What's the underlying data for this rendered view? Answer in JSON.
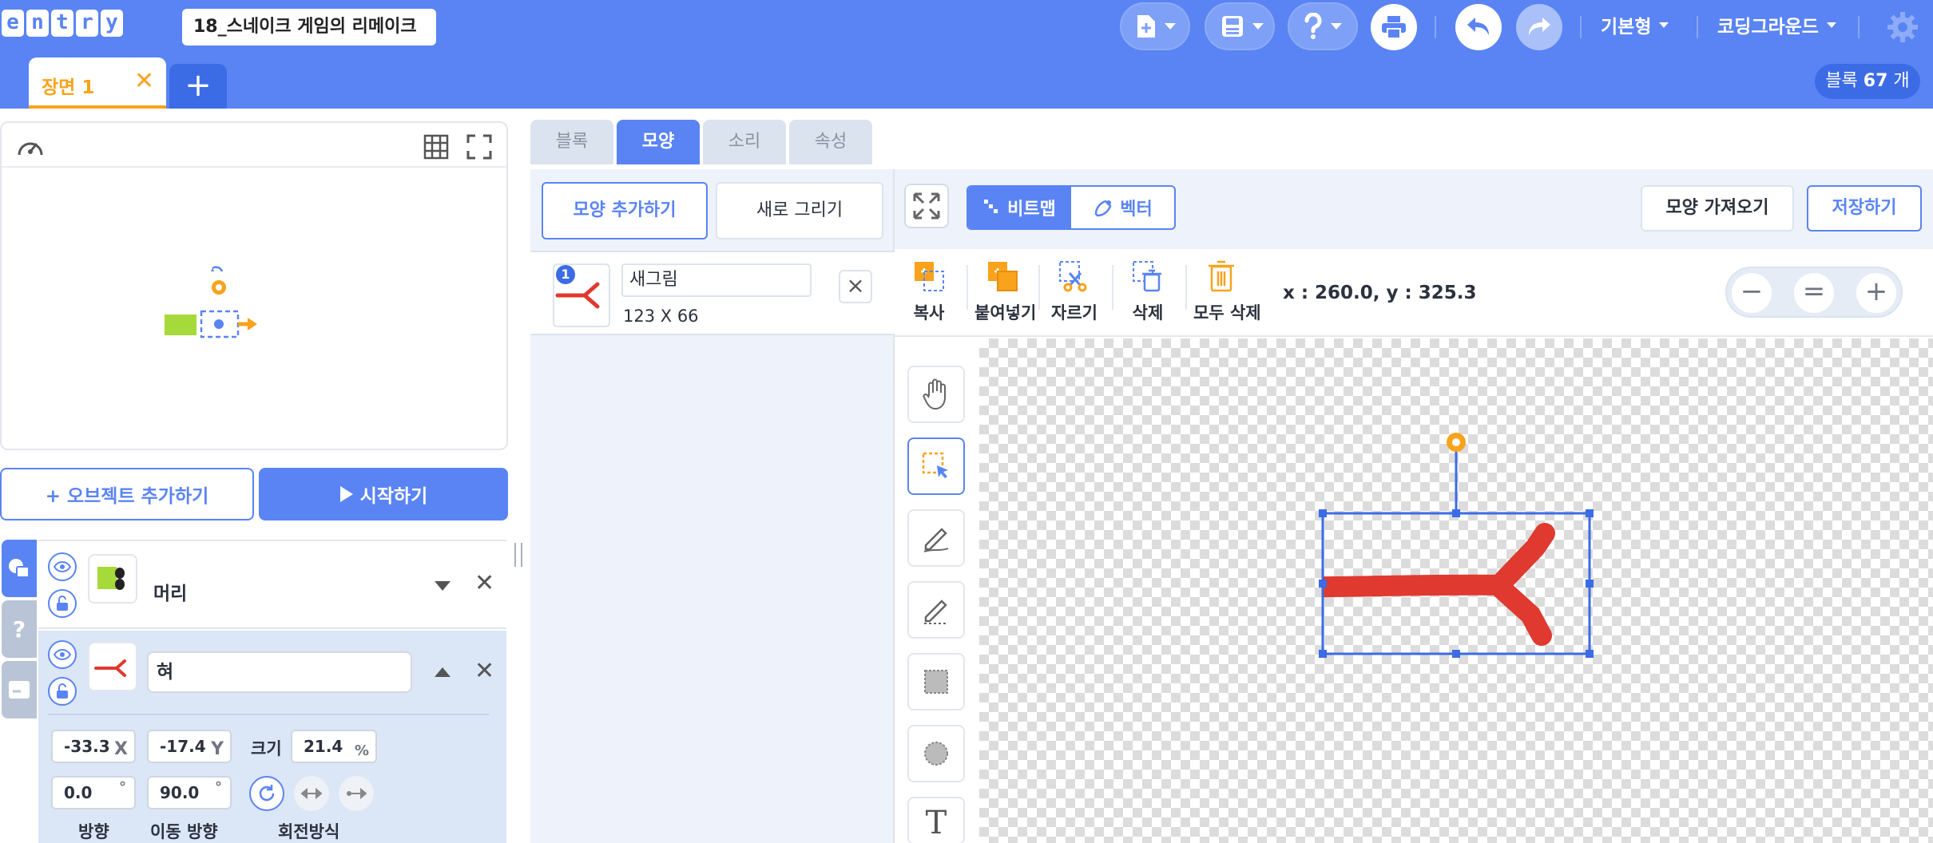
{
  "app": {
    "logo_letters": [
      "e",
      "n",
      "t",
      "r",
      "y"
    ],
    "project_title": "18_스네이크 게임의 리메이크"
  },
  "toolbar": {
    "menu_mode": "기본형",
    "menu_user": "코딩그라운드"
  },
  "scene": {
    "tab_label": "장면 1",
    "close_glyph": "✕",
    "add_glyph": "+"
  },
  "block_count": {
    "prefix": "블록",
    "count": "67",
    "suffix": "개"
  },
  "left": {
    "add_object": "+ 오브젝트 추가하기",
    "start": "시작하기"
  },
  "objects": [
    {
      "name": "머리"
    },
    {
      "name": "혀"
    }
  ],
  "props": {
    "x": "-33.3",
    "x_label": "X",
    "y": "-17.4",
    "y_label": "Y",
    "size_label": "크기",
    "size": "21.4",
    "size_unit": "%",
    "direction": "0.0",
    "move_direction": "90.0",
    "degree": "°",
    "direction_label": "방향",
    "move_direction_label": "이동 방향",
    "rotation_label": "회전방식"
  },
  "mode_tabs": [
    {
      "label": "블록",
      "active": false
    },
    {
      "label": "모양",
      "active": true
    },
    {
      "label": "소리",
      "active": false
    },
    {
      "label": "속성",
      "active": false
    }
  ],
  "shapes": {
    "add_label": "모양 추가하기",
    "new_label": "새로 그리기",
    "items": [
      {
        "index": "1",
        "name": "새그림",
        "size": "123 X 66"
      }
    ]
  },
  "paint": {
    "bitmap_label": "비트맵",
    "vector_label": "벡터",
    "import_label": "모양 가져오기",
    "save_label": "저장하기",
    "tools": {
      "copy": "복사",
      "paste": "붙여넣기",
      "cut": "자르기",
      "delete": "삭제",
      "delete_all": "모두 삭제"
    },
    "coords": "x : 260.0, y : 325.3",
    "zoom": {
      "out": "−",
      "reset": "=",
      "in": "+"
    },
    "text_tool": "T"
  },
  "colors": {
    "primary": "#5a84f3",
    "orange": "#f9a21c",
    "tongue_red": "#e0392f"
  }
}
